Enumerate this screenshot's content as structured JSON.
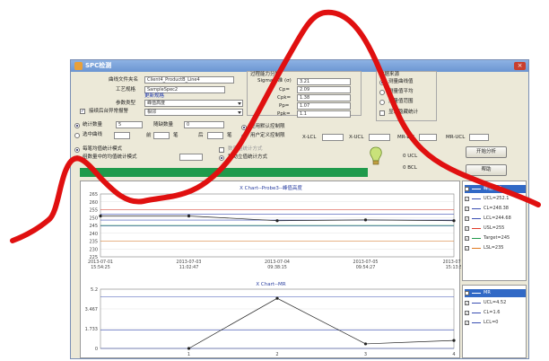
{
  "window": {
    "title": "SPC检测"
  },
  "form": {
    "curve_file_label": "曲线文件夹名",
    "curve_file_value": "Client4_ProductB_Line4",
    "process_label": "工艺规格",
    "process_value": "SampleSpec2",
    "process_link": "更新规格",
    "param_type_label": "参数类型",
    "param_type_value": "峰值高度",
    "auto_anomaly_label": "接续后台异常报警",
    "auto_anomaly_value": "相邻",
    "stat_count_label": "统计数量",
    "stat_count_value": "5",
    "random_count_label": "随缺数量",
    "random_count_value": "0",
    "select_curve_label": "选中曲线",
    "front_label": "前",
    "front_unit": "笔",
    "back_label": "后",
    "back_unit": "笔",
    "each_group_label": "每笔均值统计模式",
    "group_mean_label": "组数量中的均值统计模式",
    "apply_default_label": "应用默认控制限",
    "user_defined_label": "用户定义控制限",
    "enable_group_label": "数量组统计方式",
    "moving_group_label": "移动立值统计方式"
  },
  "capability": {
    "title": "过程能力分析",
    "sigma_label": "Sigma水准 (σ)",
    "sigma_value": "3.21",
    "cp_label": "Cp=",
    "cp_value": "2.09",
    "cpk_label": "Cpk=",
    "cpk_value": "1.38",
    "pp_label": "Pp=",
    "pp_value": "1.07",
    "ppk_label": "Ppk=",
    "ppk_value": "1.1"
  },
  "data_source": {
    "title": "数据来源",
    "opt1": "测量曲线值",
    "opt2": "测量值平均",
    "opt3": "测量值范围",
    "show_recent": "显示隐藏统计"
  },
  "limits": {
    "x_lcl": "X-LCL",
    "x_ucl": "X-UCL",
    "mr_lcl": "MR-LCL",
    "mr_ucl": "MR-UCL",
    "lcl_label": "0 UCL",
    "lcl2_label": "0 BCL"
  },
  "buttons": {
    "start": "开始分析",
    "help": "帮助"
  },
  "chart1": {
    "title": "X Chart--Probe3--峰值高度",
    "yticks": [
      "265",
      "260",
      "255",
      "250",
      "245",
      "240",
      "235",
      "230",
      "225"
    ],
    "xticks": [
      "2013-07-01\n15:54:25",
      "2013-07-03\n11:02:47",
      "2013-07-04\n09:38:15",
      "2013-07-05\n09:54:27",
      "2013-07-0\n15:13:5"
    ]
  },
  "chart2": {
    "title": "X Chart--MR",
    "yticks": [
      "5.2",
      "3.467",
      "1.733",
      "0"
    ],
    "xticks": [
      "1",
      "2",
      "3",
      "4"
    ]
  },
  "legend1": [
    {
      "label": "峰值高度",
      "color": "#222222",
      "highlight": true
    },
    {
      "label": "UCL=252.1",
      "color": "#3a4fb2",
      "highlight": false
    },
    {
      "label": "CL=248.38",
      "color": "#3a4fb2",
      "highlight": false
    },
    {
      "label": "LCL=244.68",
      "color": "#3a4fb2",
      "highlight": false
    },
    {
      "label": "USL=255",
      "color": "#e03a2a",
      "highlight": false
    },
    {
      "label": "Target=245",
      "color": "#1f9a4b",
      "highlight": false
    },
    {
      "label": "LSL=235",
      "color": "#e07a20",
      "highlight": false
    }
  ],
  "legend2": [
    {
      "label": "MR",
      "color": "#222222",
      "highlight": true
    },
    {
      "label": "UCL=4.52",
      "color": "#3a4fb2",
      "highlight": false
    },
    {
      "label": "CL=1.6",
      "color": "#3a4fb2",
      "highlight": false
    },
    {
      "label": "LCL=0",
      "color": "#3a4fb2",
      "highlight": false
    }
  ],
  "chart_data": [
    {
      "type": "line",
      "title": "X Chart--Probe3--峰值高度",
      "x": [
        "2013-07-01 15:54:25",
        "2013-07-03 11:02:47",
        "2013-07-04 09:38:15",
        "2013-07-05 09:54:27",
        "2013-07-0 15:13:5"
      ],
      "series": [
        {
          "name": "峰值高度",
          "values": [
            251,
            251,
            248,
            248.5,
            248
          ]
        },
        {
          "name": "UCL=252.1",
          "values": [
            252.1,
            252.1,
            252.1,
            252.1,
            252.1
          ]
        },
        {
          "name": "CL=248.38",
          "values": [
            248.38,
            248.38,
            248.38,
            248.38,
            248.38
          ]
        },
        {
          "name": "LCL=244.68",
          "values": [
            244.68,
            244.68,
            244.68,
            244.68,
            244.68
          ]
        },
        {
          "name": "USL=255",
          "values": [
            255,
            255,
            255,
            255,
            255
          ]
        },
        {
          "name": "Target=245",
          "values": [
            245,
            245,
            245,
            245,
            245
          ]
        },
        {
          "name": "LSL=235",
          "values": [
            235,
            235,
            235,
            235,
            235
          ]
        }
      ],
      "ylim": [
        225,
        265
      ],
      "grid": true,
      "legend": "right"
    },
    {
      "type": "line",
      "title": "X Chart--MR",
      "x": [
        1,
        2,
        3,
        4
      ],
      "series": [
        {
          "name": "MR",
          "values": [
            0,
            4.4,
            0.4,
            0.7
          ]
        },
        {
          "name": "UCL=4.52",
          "values": [
            4.52,
            4.52,
            4.52,
            4.52
          ]
        },
        {
          "name": "CL=1.6",
          "values": [
            1.6,
            1.6,
            1.6,
            1.6
          ]
        },
        {
          "name": "LCL=0",
          "values": [
            0,
            0,
            0,
            0
          ]
        }
      ],
      "ylim": [
        0,
        5.2
      ],
      "grid": true,
      "legend": "right"
    }
  ]
}
